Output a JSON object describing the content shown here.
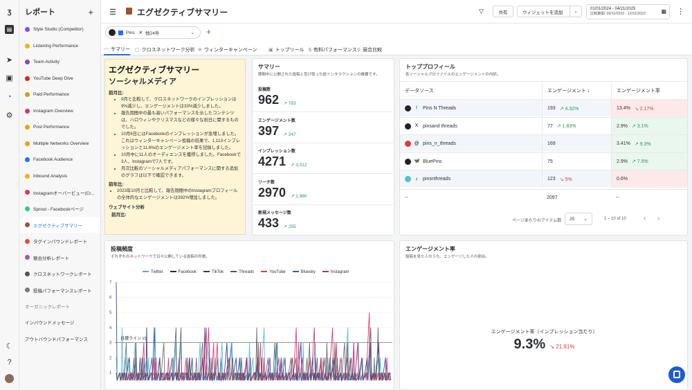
{
  "rail": {
    "icons": [
      "logo-icon",
      "compose-icon",
      "send-icon",
      "inbox-icon",
      "reports-icon",
      "settings-icon"
    ],
    "bottom_icons": [
      "dark-mode-icon",
      "help-icon",
      "avatar"
    ]
  },
  "sidebar": {
    "title": "レポート",
    "add": "+",
    "items": [
      {
        "label": "Style Studio (Competitor)",
        "color": "#7c4dff"
      },
      {
        "label": "Listening Performance",
        "color": "#f5b400"
      },
      {
        "label": "Team Activity",
        "color": "#8e44ad"
      },
      {
        "label": "YouTube Deep Dive",
        "color": "#e02020"
      },
      {
        "label": "Paid Performance",
        "color": "#d4a017"
      },
      {
        "label": "Instagram Overview",
        "color": "#e1306c"
      },
      {
        "label": "Post Performance",
        "color": "#f0a500"
      },
      {
        "label": "Multiple Networks Overview",
        "color": "#f39c12"
      },
      {
        "label": "Facebook Audience",
        "color": "#1877f2"
      },
      {
        "label": "Inbound Analysis",
        "color": "#f5b400"
      },
      {
        "label": "Instagramオーバービュー(Cr...",
        "color": "#e1306c"
      },
      {
        "label": "Sprout - Facebookページ",
        "color": "#2ecc71"
      },
      {
        "label": "エグゼクティブサマリー",
        "color": "#a0522d"
      },
      {
        "label": "タグインパウンドレポート",
        "color": "#e74c3c"
      },
      {
        "label": "競合分析レポート",
        "color": "#9b59b6"
      },
      {
        "label": "クロスネットワークレポート",
        "color": "#555"
      },
      {
        "label": "投稿パフォーマンスレポート",
        "color": "#777"
      }
    ],
    "sections": [
      "オーガニックレポート",
      "インバウンドメッセージ",
      "アウトバウンドパフォーマンス"
    ]
  },
  "header": {
    "title": "エグゼクティブサマリー",
    "filter": "▽",
    "share": "共有",
    "add_widget": "ウィジェットを追加",
    "date_range": "01/01/2024 - 04/21/2025",
    "compare": "比較期間: 09/11/2022 - 12/31/2023",
    "more": "⋮"
  },
  "filters": {
    "profile": "Pins",
    "others": "他24件",
    "add": "+"
  },
  "tabs": [
    "サマリー",
    "クロスネットワーク分析",
    "ウィンターキャンペーン",
    "トップリール",
    "有料パフォーマンス",
    "競合比較"
  ],
  "exec": {
    "title": "エグゼクティブサマリー",
    "subtitle": "ソーシャルメディア",
    "prev_month": "前月比:",
    "bullets": [
      "9月と比較して、クロスネットワークのインプレッションは9%減少し、エンゲージメントは33%減少しました。",
      "報告期間中の最も高いパフォーマンスを示したコンテンツは、ハロウィンやクリスマスなどの様々な祝日に関するものでした。",
      "10月6日にはFacebookのインプレッションが急増しました。これはウィンターキャンペーン投稿の結果で、1,113インプレッションと11.8%のエンゲージメント率を記録しました。",
      "10月中に11人のオーディエンスを獲得しました。Facebookで3人、Instagramで7人です。",
      "月次比較のソーシャルメディアパフォーマンスに関する追加のグラフは以下で確認できます。"
    ],
    "prev_year": "前年比:",
    "year_bullets": [
      "2023年10月と比較して、報告期間中のInstagramプロフィールの全体的なエンゲージメントは392%増加しました。"
    ],
    "web": "ウェブサイト分析",
    "web_prev": "前月比:"
  },
  "summary": {
    "title": "サマリー",
    "subtitle": "期間中に公開された投稿と受け取った総インタラクションの概要です。",
    "metrics": [
      {
        "label": "投稿数",
        "value": "962",
        "delta": "↗ 783"
      },
      {
        "label": "エンゲージメント数",
        "value": "397",
        "delta": "↗ 247"
      },
      {
        "label": "インプレッション数",
        "value": "4271",
        "delta": "↗ 3,012"
      },
      {
        "label": "リーチ数",
        "value": "2970",
        "delta": "↗ 1,980"
      },
      {
        "label": "新規メッセージ数",
        "value": "433",
        "delta": "↗ 255"
      }
    ]
  },
  "top_profiles": {
    "title": "トッププロフィール",
    "subtitle": "各ソーシャルプロファイルのエンゲージメントの内訳。",
    "headers": [
      "データソース",
      "エンゲージメント ↓",
      "エンゲージメント率"
    ],
    "rows": [
      {
        "name": "Pins N Threads",
        "net": "f",
        "eng": "193",
        "eng_d": "↗ 4.32%",
        "eng_dir": "up",
        "rate": "13.4%",
        "rate_d": "↘ 2.17%",
        "rate_dir": "dn"
      },
      {
        "name": "pinsand threads",
        "net": "X",
        "eng": "77",
        "eng_d": "↗ 1.83%",
        "eng_dir": "up",
        "rate": "2.9%",
        "rate_d": "↗ 3.1%",
        "rate_dir": "up"
      },
      {
        "name": "pins_n_threads",
        "net": "@",
        "eng": "169",
        "eng_d": "",
        "eng_dir": "",
        "rate": "3.41%",
        "rate_d": "↗ 9.3%",
        "rate_dir": "up"
      },
      {
        "name": "BluePins",
        "net": "🦋",
        "eng": "75",
        "eng_d": "",
        "eng_dir": "",
        "rate": "2.9%",
        "rate_d": "↗ 7.9%",
        "rate_dir": "up"
      },
      {
        "name": "pinsnthreads",
        "net": "♪",
        "eng": "123",
        "eng_d": "↘ 5%",
        "eng_dir": "dn",
        "rate": "0.6%",
        "rate_d": "",
        "rate_dir": ""
      }
    ],
    "total": {
      "name": "--",
      "eng": "2097",
      "rate": "--"
    },
    "pager": {
      "label": "ページあたりのアイテム数",
      "size": "25",
      "range": "1 – 10 of 10",
      "prev": "‹",
      "next": "›"
    }
  },
  "post_freq": {
    "title": "投稿頻度",
    "subtitle": "それぞれのネットワークで日々公開している投稿の件数。",
    "legend": [
      {
        "name": "Twitter",
        "color": "#3bb3e0"
      },
      {
        "name": "Facebook",
        "color": "#1a237e"
      },
      {
        "name": "TikTok",
        "color": "#2c3e50"
      },
      {
        "name": "Threads",
        "color": "#555"
      },
      {
        "name": "YouTube",
        "color": "#e53935"
      },
      {
        "name": "Bluesky",
        "color": "#1565c0"
      },
      {
        "name": "Instagram",
        "color": "#d81b60"
      }
    ],
    "target": "目標ライン #1",
    "yticks": [
      "7",
      "6",
      "5",
      "4",
      "3",
      "2",
      "1"
    ]
  },
  "engagement": {
    "title": "エンゲージメント率",
    "subtitle": "投稿を見た人のうち、エンゲージした人の割合。",
    "metric_label": "エンゲージメント率（インプレッション当たり）",
    "value": "9.3%",
    "delta": "↘ 21.91%"
  }
}
